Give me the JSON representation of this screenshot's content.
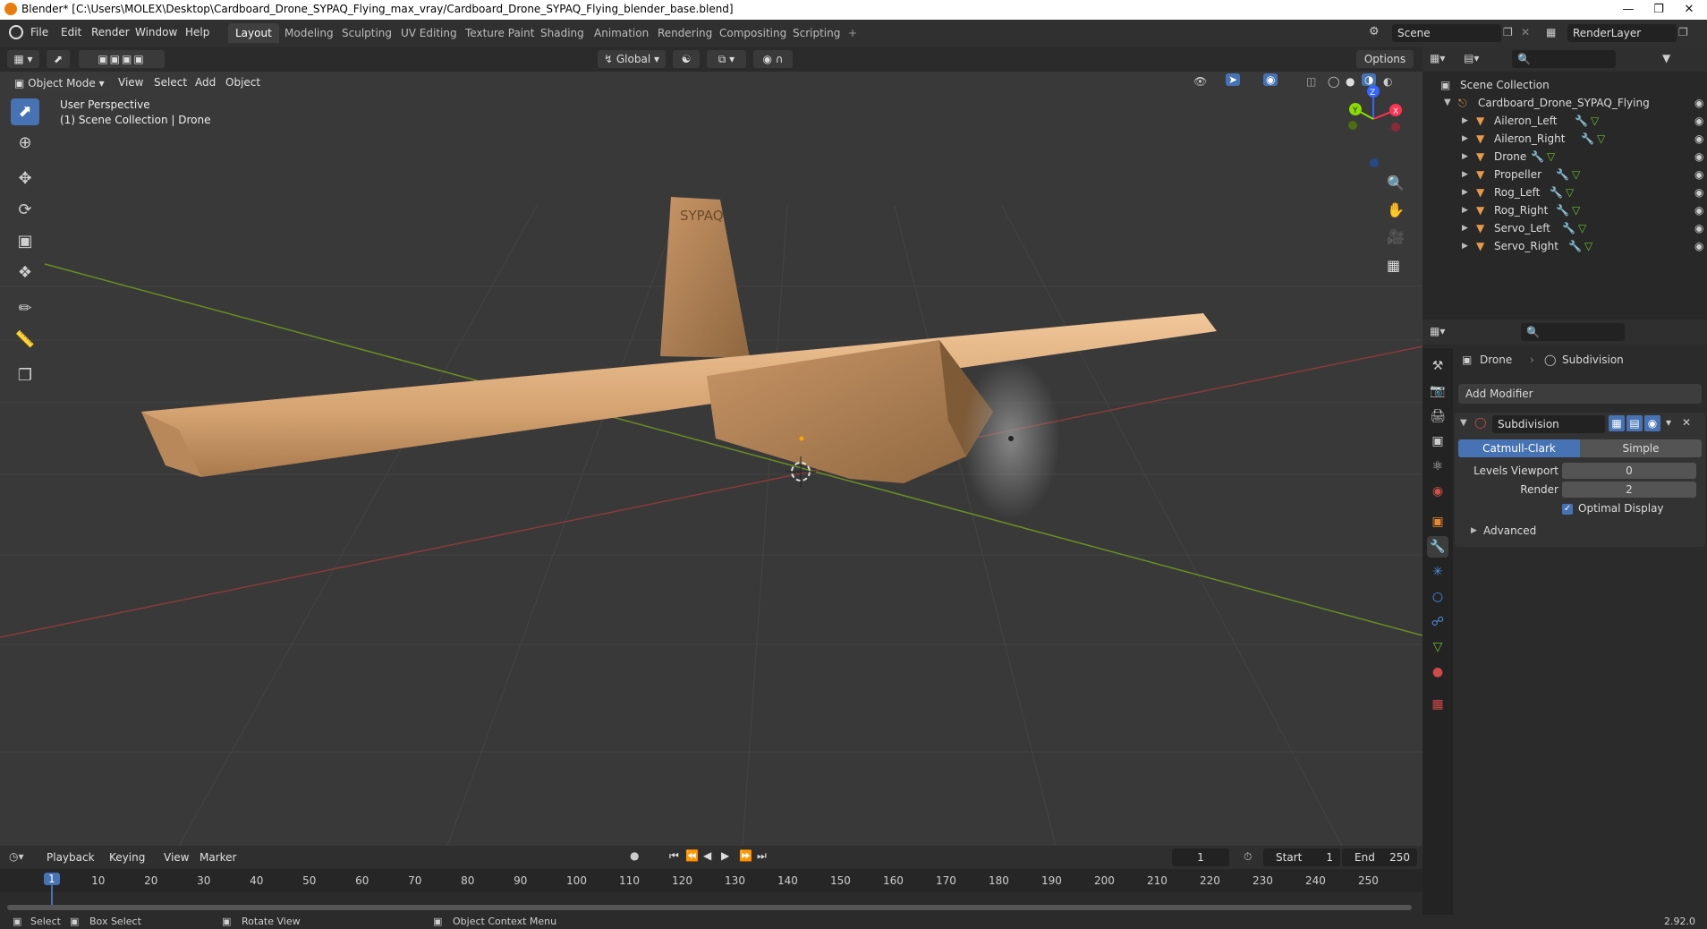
{
  "window": {
    "title": "Blender* [C:\\Users\\MOLEX\\Desktop\\Cardboard_Drone_SYPAQ_Flying_max_vray/Cardboard_Drone_SYPAQ_Flying_blender_base.blend]"
  },
  "menu": [
    "File",
    "Edit",
    "Render",
    "Window",
    "Help"
  ],
  "workspaces": [
    "Layout",
    "Modeling",
    "Sculpting",
    "UV Editing",
    "Texture Paint",
    "Shading",
    "Animation",
    "Rendering",
    "Compositing",
    "Scripting"
  ],
  "active_workspace": "Layout",
  "scene": {
    "name": "Scene",
    "view_layer": "RenderLayer"
  },
  "header": {
    "transform_orientation": "Global",
    "options_label": "Options",
    "mode": "Object Mode",
    "view_menu": [
      "View",
      "Select",
      "Add",
      "Object"
    ]
  },
  "viewport": {
    "overlay_line1": "User Perspective",
    "overlay_line2": "(1) Scene Collection | Drone",
    "model_label": "SYPAQ",
    "gizmo": {
      "x": "X",
      "y": "Y",
      "z": "Z"
    }
  },
  "outliner": {
    "root": "Scene Collection",
    "collection": "Cardboard_Drone_SYPAQ_Flying",
    "objects": [
      "Aileron_Left",
      "Aileron_Right",
      "Drone",
      "Propeller",
      "Rog_Left",
      "Rog_Right",
      "Servo_Left",
      "Servo_Right"
    ]
  },
  "properties": {
    "object_name": "Drone",
    "modifier_breadcrumb": "Subdivision",
    "add_modifier_label": "Add Modifier",
    "modifier": {
      "name": "Subdivision",
      "type_options": [
        "Catmull-Clark",
        "Simple"
      ],
      "active_type": "Catmull-Clark",
      "levels_viewport_label": "Levels Viewport",
      "levels_viewport": "0",
      "render_label": "Render",
      "render": "2",
      "optimal_display_label": "Optimal Display",
      "optimal_display": true,
      "advanced_label": "Advanced"
    }
  },
  "timeline": {
    "menus": [
      "Playback",
      "Keying",
      "View",
      "Marker"
    ],
    "current_frame": "1",
    "start_label": "Start",
    "start": "1",
    "end_label": "End",
    "end": "250",
    "ruler": [
      "1",
      "10",
      "20",
      "30",
      "40",
      "50",
      "60",
      "70",
      "80",
      "90",
      "100",
      "110",
      "120",
      "130",
      "140",
      "150",
      "160",
      "170",
      "180",
      "190",
      "200",
      "210",
      "220",
      "230",
      "240",
      "250"
    ]
  },
  "statusbar": {
    "select": "Select",
    "box_select": "Box Select",
    "rotate_view": "Rotate View",
    "context_menu": "Object Context Menu",
    "version": "2.92.0"
  },
  "colors": {
    "accent": "#4772b3",
    "background": "#393939",
    "panel": "#2b2b2b",
    "cardboard": "#d8a877"
  }
}
